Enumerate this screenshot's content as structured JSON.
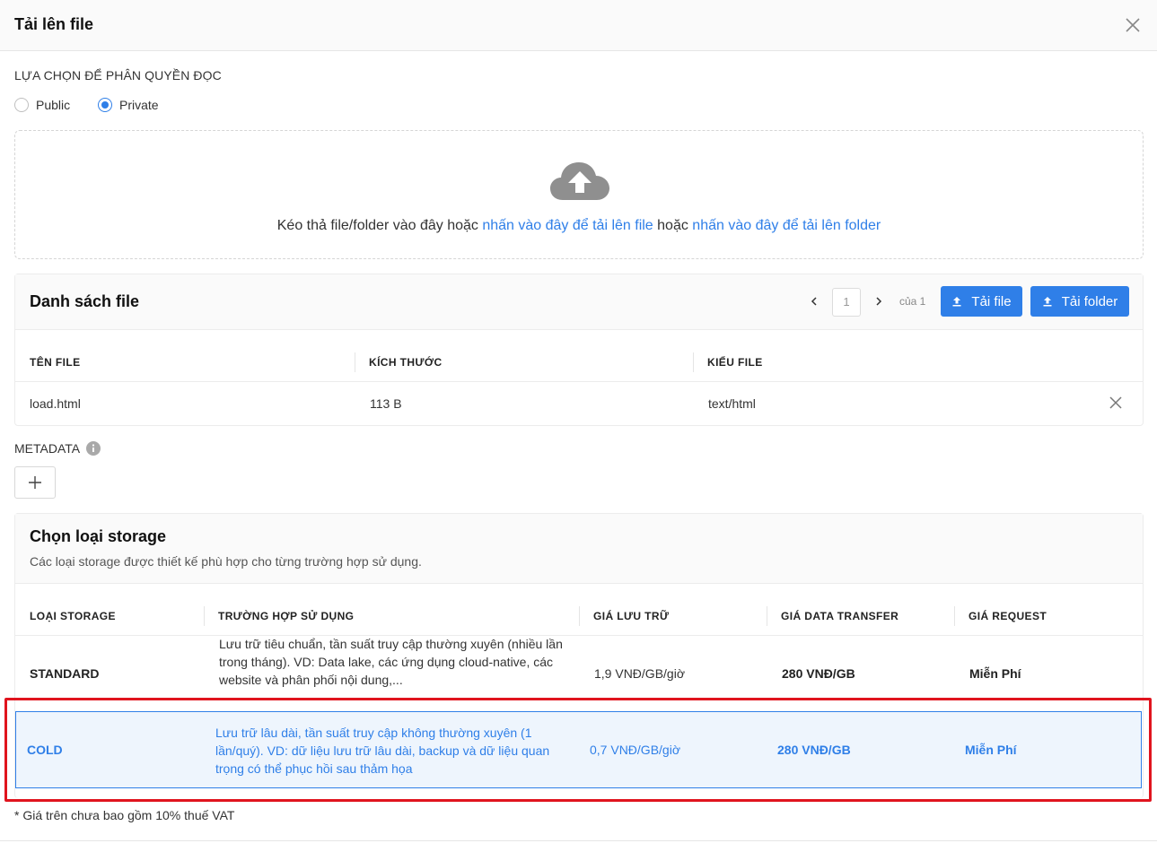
{
  "dialog": {
    "title": "Tải lên file"
  },
  "permission": {
    "label": "LỰA CHỌN ĐỂ PHÂN QUYỀN ĐỌC",
    "options": [
      {
        "label": "Public",
        "checked": false
      },
      {
        "label": "Private",
        "checked": true
      }
    ]
  },
  "dropzone": {
    "text_before": "Kéo thả file/folder vào đây hoặc ",
    "link_file": "nhấn vào đây để tải lên file",
    "text_middle": " hoặc ",
    "link_folder": "nhấn vào đây để tải lên folder",
    "icon": "cloud-upload-icon"
  },
  "file_list": {
    "title": "Danh sách file",
    "pager": {
      "current": "1",
      "of_text": "của 1"
    },
    "upload_file_label": "Tải file",
    "upload_folder_label": "Tải folder",
    "columns": [
      "TÊN FILE",
      "KÍCH THƯỚC",
      "KIỂU FILE"
    ],
    "rows": [
      {
        "name": "load.html",
        "size": "113 B",
        "type": "text/html"
      }
    ]
  },
  "metadata": {
    "label": "METADATA"
  },
  "storage": {
    "title": "Chọn loại storage",
    "subtitle": "Các loại storage được thiết kế phù hợp cho từng trường hợp sử dụng.",
    "columns": [
      "LOẠI STORAGE",
      "TRƯỜNG HỢP SỬ DỤNG",
      "GIÁ LƯU TRỮ",
      "GIÁ DATA TRANSFER",
      "GIÁ REQUEST"
    ],
    "rows": [
      {
        "type": "STANDARD",
        "use_case": "Lưu trữ tiêu chuẩn, tần suất truy cập thường xuyên (nhiều lần trong tháng). VD: Data lake, các ứng dụng cloud-native, các website và phân phối nội dung,...",
        "storage_price": "1,9 VNĐ/GB/giờ",
        "transfer_price": "280 VNĐ/GB",
        "request_price": "Miễn Phí",
        "selected": false
      },
      {
        "type": "COLD",
        "use_case": "Lưu trữ lâu dài, tần suất truy cập không thường xuyên (1 lần/quý). VD: dữ liệu lưu trữ lâu dài, backup và dữ liệu quan trọng có thể phục hồi sau thảm họa",
        "storage_price": "0,7 VNĐ/GB/giờ",
        "transfer_price": "280 VNĐ/GB",
        "request_price": "Miễn Phí",
        "selected": true
      }
    ],
    "note": "* Giá trên chưa bao gồm 10% thuế VAT"
  },
  "colors": {
    "accent": "#2f7fe8",
    "highlight": "#e0141e",
    "selected_bg": "#eef5fd"
  }
}
